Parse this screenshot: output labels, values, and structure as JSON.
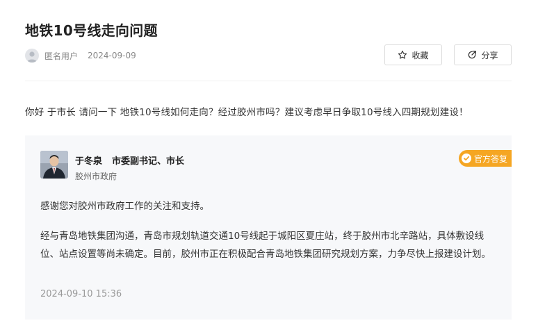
{
  "page_title": "地铁10号线走向问题",
  "author": {
    "name": "匿名用户",
    "date": "2024-09-09",
    "avatar_icon": "user-icon"
  },
  "actions": {
    "collect_label": "收藏",
    "collect_icon": "star-icon",
    "share_label": "分享",
    "share_icon": "share-icon"
  },
  "question": "你好 于市长 请问一下 地铁10号线如何走向？经过胶州市吗？建议考虑早日争取10号线入四期规划建设！",
  "reply": {
    "official_name": "于冬泉",
    "official_title": "市委副书记、市长",
    "organization": "胶州市政府",
    "badge_label": "官方答复",
    "badge_icon": "official-check-icon",
    "paragraph1": "感谢您对胶州市政府工作的关注和支持。",
    "paragraph2": "经与青岛地铁集团沟通，青岛市规划轨道交通10号线起于城阳区夏庄站，终于胶州市北辛路站，具体敷设线位、站点设置等尚未确定。目前，胶州市正在积极配合青岛地铁集团研究规划方案，力争尽快上报建设计划。",
    "date": "2024-09-10 15:36"
  },
  "colors": {
    "badge": "#f5a623",
    "card_background": "#f7f8fa",
    "muted_text": "#999999"
  }
}
